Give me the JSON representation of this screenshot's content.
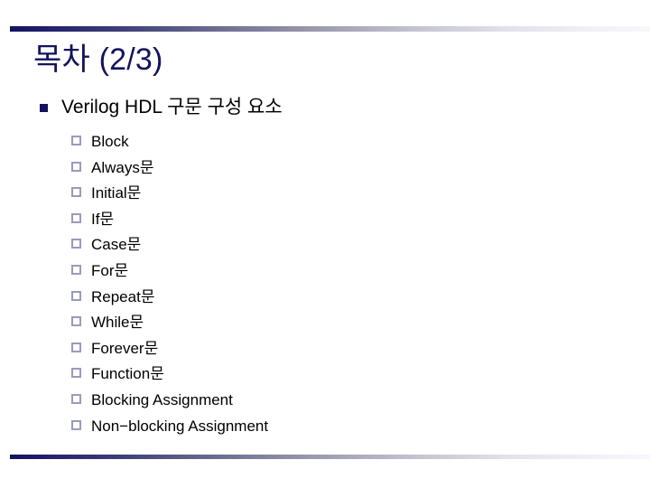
{
  "slide": {
    "title": "목차 (2/3)",
    "title_color": "#13135c",
    "background_color": "#ffffff",
    "rule_gradient_start": "#13135c",
    "rule_gradient_end": "#f7f8fc",
    "level1_bullet_color": "#13135c",
    "level2_bullet_color": "#9a9ac0",
    "outline": [
      {
        "label": "Verilog HDL 구문 구성 요소",
        "children": [
          {
            "label": "Block"
          },
          {
            "label": "Always문"
          },
          {
            "label": "Initial문"
          },
          {
            "label": "If문"
          },
          {
            "label": "Case문"
          },
          {
            "label": "For문"
          },
          {
            "label": "Repeat문"
          },
          {
            "label": "While문"
          },
          {
            "label": "Forever문"
          },
          {
            "label": "Function문"
          },
          {
            "label": "Blocking Assignment"
          },
          {
            "label": "Non−blocking Assignment"
          }
        ]
      }
    ]
  }
}
